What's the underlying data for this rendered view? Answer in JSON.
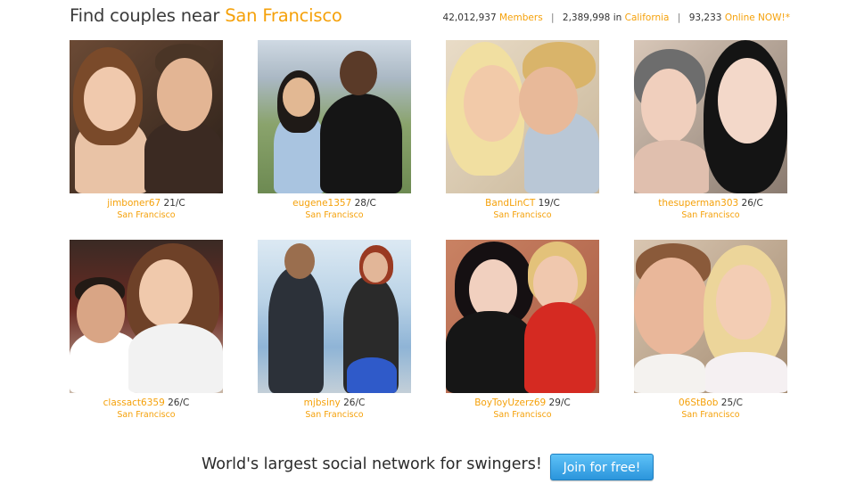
{
  "header": {
    "title_prefix": "Find couples near",
    "city": "San Francisco",
    "stats": {
      "members_count": "42,012,937",
      "members_label": "Members",
      "state_count": "2,389,998",
      "state_in": "in",
      "state_name": "California",
      "online_count": "93,233",
      "online_label": "Online NOW!*"
    }
  },
  "profiles": [
    {
      "username": "jimboner67",
      "age_type": "21/C",
      "location": "San Francisco"
    },
    {
      "username": "eugene1357",
      "age_type": "28/C",
      "location": "San Francisco"
    },
    {
      "username": "BandLinCT",
      "age_type": "19/C",
      "location": "San Francisco"
    },
    {
      "username": "thesuperman303",
      "age_type": "26/C",
      "location": "San Francisco"
    },
    {
      "username": "classact6359",
      "age_type": "26/C",
      "location": "San Francisco"
    },
    {
      "username": "mjbsiny",
      "age_type": "26/C",
      "location": "San Francisco"
    },
    {
      "username": "BoyToyUzerz69",
      "age_type": "29/C",
      "location": "San Francisco"
    },
    {
      "username": "06StBob",
      "age_type": "25/C",
      "location": "San Francisco"
    }
  ],
  "footer": {
    "tagline": "World's largest social network for swingers!",
    "join_label": "Join for free!"
  },
  "colors": {
    "accent": "#f5a10a",
    "button_top": "#5ec2f7",
    "button_bottom": "#2b95dc"
  }
}
